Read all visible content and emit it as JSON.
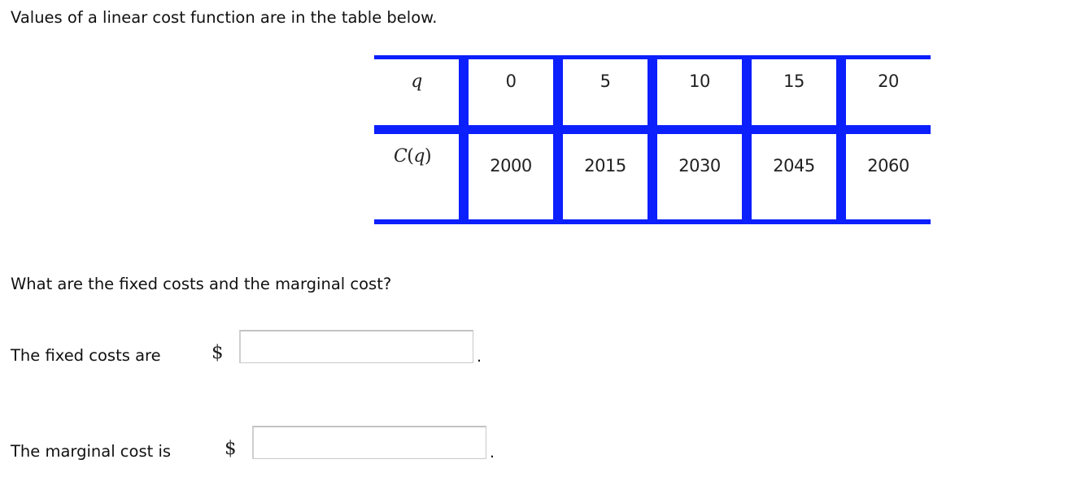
{
  "intro_text": "Values of a linear cost function are in the table below.",
  "table": {
    "row_headers": {
      "q": "q",
      "cost_func_name": "C",
      "cost_func_arg": "q"
    },
    "q_values": [
      "0",
      "5",
      "10",
      "15",
      "20"
    ],
    "cost_values": [
      "2000",
      "2015",
      "2030",
      "2045",
      "2060"
    ],
    "border_color": "#0c1ffd"
  },
  "question_text": "What are the fixed costs and the marginal cost?",
  "answers": {
    "fixed_costs": {
      "label": "The fixed costs are",
      "currency_symbol": "$",
      "value": "",
      "placeholder": "",
      "trailing": "."
    },
    "marginal_cost": {
      "label": "The marginal cost is",
      "currency_symbol": "$",
      "value": "",
      "placeholder": "",
      "trailing": "."
    }
  }
}
